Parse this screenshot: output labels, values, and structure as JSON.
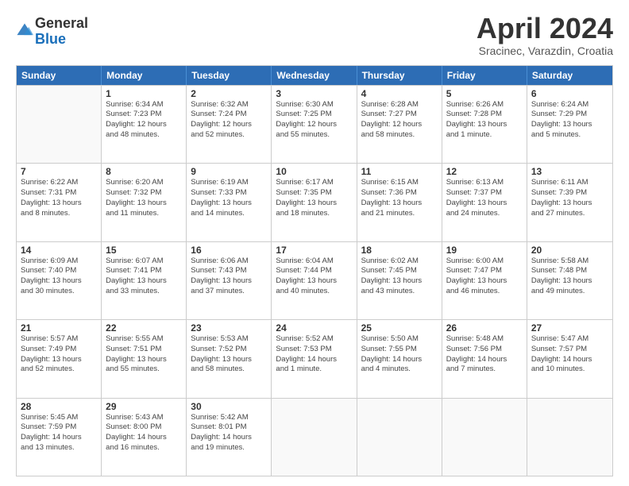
{
  "logo": {
    "line1": "General",
    "line2": "Blue"
  },
  "title": "April 2024",
  "location": "Sracinec, Varazdin, Croatia",
  "days": [
    "Sunday",
    "Monday",
    "Tuesday",
    "Wednesday",
    "Thursday",
    "Friday",
    "Saturday"
  ],
  "weeks": [
    [
      {
        "date": "",
        "info": ""
      },
      {
        "date": "1",
        "info": "Sunrise: 6:34 AM\nSunset: 7:23 PM\nDaylight: 12 hours\nand 48 minutes."
      },
      {
        "date": "2",
        "info": "Sunrise: 6:32 AM\nSunset: 7:24 PM\nDaylight: 12 hours\nand 52 minutes."
      },
      {
        "date": "3",
        "info": "Sunrise: 6:30 AM\nSunset: 7:25 PM\nDaylight: 12 hours\nand 55 minutes."
      },
      {
        "date": "4",
        "info": "Sunrise: 6:28 AM\nSunset: 7:27 PM\nDaylight: 12 hours\nand 58 minutes."
      },
      {
        "date": "5",
        "info": "Sunrise: 6:26 AM\nSunset: 7:28 PM\nDaylight: 13 hours\nand 1 minute."
      },
      {
        "date": "6",
        "info": "Sunrise: 6:24 AM\nSunset: 7:29 PM\nDaylight: 13 hours\nand 5 minutes."
      }
    ],
    [
      {
        "date": "7",
        "info": "Sunrise: 6:22 AM\nSunset: 7:31 PM\nDaylight: 13 hours\nand 8 minutes."
      },
      {
        "date": "8",
        "info": "Sunrise: 6:20 AM\nSunset: 7:32 PM\nDaylight: 13 hours\nand 11 minutes."
      },
      {
        "date": "9",
        "info": "Sunrise: 6:19 AM\nSunset: 7:33 PM\nDaylight: 13 hours\nand 14 minutes."
      },
      {
        "date": "10",
        "info": "Sunrise: 6:17 AM\nSunset: 7:35 PM\nDaylight: 13 hours\nand 18 minutes."
      },
      {
        "date": "11",
        "info": "Sunrise: 6:15 AM\nSunset: 7:36 PM\nDaylight: 13 hours\nand 21 minutes."
      },
      {
        "date": "12",
        "info": "Sunrise: 6:13 AM\nSunset: 7:37 PM\nDaylight: 13 hours\nand 24 minutes."
      },
      {
        "date": "13",
        "info": "Sunrise: 6:11 AM\nSunset: 7:39 PM\nDaylight: 13 hours\nand 27 minutes."
      }
    ],
    [
      {
        "date": "14",
        "info": "Sunrise: 6:09 AM\nSunset: 7:40 PM\nDaylight: 13 hours\nand 30 minutes."
      },
      {
        "date": "15",
        "info": "Sunrise: 6:07 AM\nSunset: 7:41 PM\nDaylight: 13 hours\nand 33 minutes."
      },
      {
        "date": "16",
        "info": "Sunrise: 6:06 AM\nSunset: 7:43 PM\nDaylight: 13 hours\nand 37 minutes."
      },
      {
        "date": "17",
        "info": "Sunrise: 6:04 AM\nSunset: 7:44 PM\nDaylight: 13 hours\nand 40 minutes."
      },
      {
        "date": "18",
        "info": "Sunrise: 6:02 AM\nSunset: 7:45 PM\nDaylight: 13 hours\nand 43 minutes."
      },
      {
        "date": "19",
        "info": "Sunrise: 6:00 AM\nSunset: 7:47 PM\nDaylight: 13 hours\nand 46 minutes."
      },
      {
        "date": "20",
        "info": "Sunrise: 5:58 AM\nSunset: 7:48 PM\nDaylight: 13 hours\nand 49 minutes."
      }
    ],
    [
      {
        "date": "21",
        "info": "Sunrise: 5:57 AM\nSunset: 7:49 PM\nDaylight: 13 hours\nand 52 minutes."
      },
      {
        "date": "22",
        "info": "Sunrise: 5:55 AM\nSunset: 7:51 PM\nDaylight: 13 hours\nand 55 minutes."
      },
      {
        "date": "23",
        "info": "Sunrise: 5:53 AM\nSunset: 7:52 PM\nDaylight: 13 hours\nand 58 minutes."
      },
      {
        "date": "24",
        "info": "Sunrise: 5:52 AM\nSunset: 7:53 PM\nDaylight: 14 hours\nand 1 minute."
      },
      {
        "date": "25",
        "info": "Sunrise: 5:50 AM\nSunset: 7:55 PM\nDaylight: 14 hours\nand 4 minutes."
      },
      {
        "date": "26",
        "info": "Sunrise: 5:48 AM\nSunset: 7:56 PM\nDaylight: 14 hours\nand 7 minutes."
      },
      {
        "date": "27",
        "info": "Sunrise: 5:47 AM\nSunset: 7:57 PM\nDaylight: 14 hours\nand 10 minutes."
      }
    ],
    [
      {
        "date": "28",
        "info": "Sunrise: 5:45 AM\nSunset: 7:59 PM\nDaylight: 14 hours\nand 13 minutes."
      },
      {
        "date": "29",
        "info": "Sunrise: 5:43 AM\nSunset: 8:00 PM\nDaylight: 14 hours\nand 16 minutes."
      },
      {
        "date": "30",
        "info": "Sunrise: 5:42 AM\nSunset: 8:01 PM\nDaylight: 14 hours\nand 19 minutes."
      },
      {
        "date": "",
        "info": ""
      },
      {
        "date": "",
        "info": ""
      },
      {
        "date": "",
        "info": ""
      },
      {
        "date": "",
        "info": ""
      }
    ]
  ]
}
